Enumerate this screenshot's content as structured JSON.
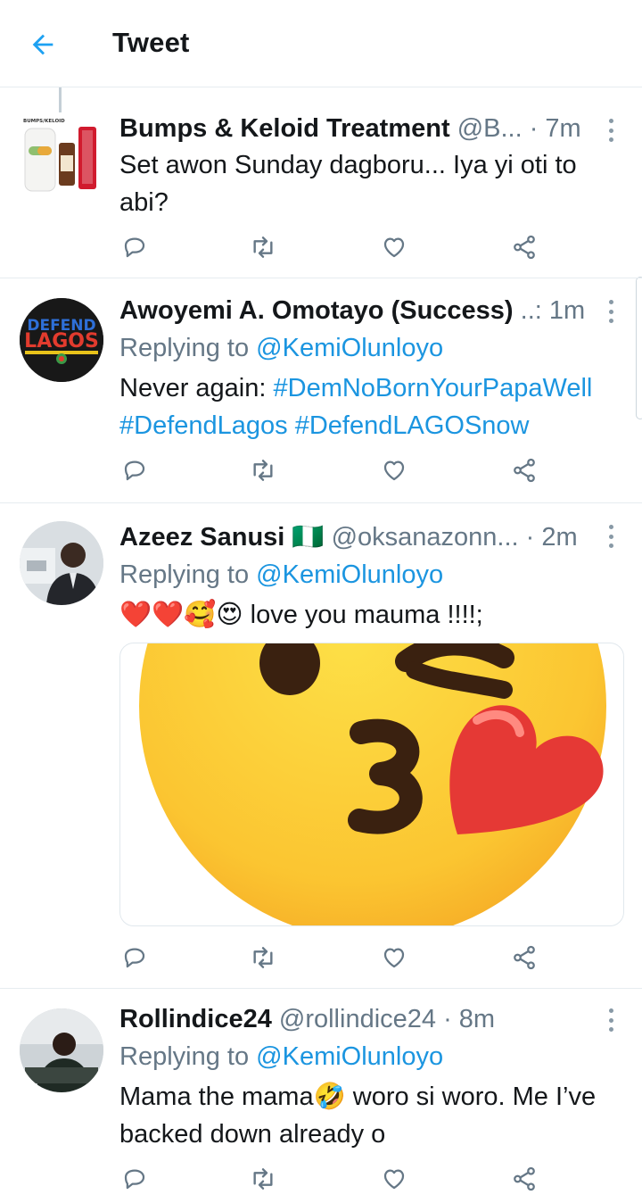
{
  "header": {
    "title": "Tweet"
  },
  "tweets": [
    {
      "name": "Bumps & Keloid Treatment",
      "handle": "@B...",
      "time": "· 7m",
      "replying_prefix": "",
      "replying_to": "",
      "text": "Set awon Sunday dagboru... Iya yi oti to abi?",
      "avatar_label": "BUMPS/KELOID"
    },
    {
      "name": "Awoyemi A. Omotayo (Success)",
      "handle": "..:",
      "time": "1m",
      "replying_prefix": "Replying to ",
      "replying_to": "@KemiOlunloyo",
      "text_prefix": "Never again: ",
      "hashtags": [
        "#DemNoBornYourPapaWell",
        "#DefendLagos",
        "#DefendLAGOSnow"
      ],
      "avatar_label": {
        "line1": "DEFEND",
        "line2": "LAGOS"
      }
    },
    {
      "name": "Azeez Sanusi",
      "flag": "🇳🇬",
      "handle": "@oksanazonn...",
      "time": "· 2m",
      "replying_prefix": "Replying to ",
      "replying_to": "@KemiOlunloyo",
      "emoji": "❤️❤️🥰😍",
      "text": "love you mauma !!!!;",
      "media": "kissing-face-emoji"
    },
    {
      "name": "Rollindice24",
      "handle": "@rollindice24",
      "time": "· 8m",
      "replying_prefix": "Replying to ",
      "replying_to": "@KemiOlunloyo",
      "text_a": "Mama the mama",
      "emoji": "🤣",
      "text_b": " woro si woro. Me I’ve backed down already o"
    }
  ],
  "icons": {
    "back": "arrow-left-icon",
    "reply": "reply-icon",
    "retweet": "retweet-icon",
    "like": "heart-icon",
    "share": "share-icon",
    "more": "more-icon"
  },
  "colors": {
    "accent": "#1da1f2",
    "link": "#1b95e0",
    "muted": "#657786",
    "icon": "#657786"
  }
}
